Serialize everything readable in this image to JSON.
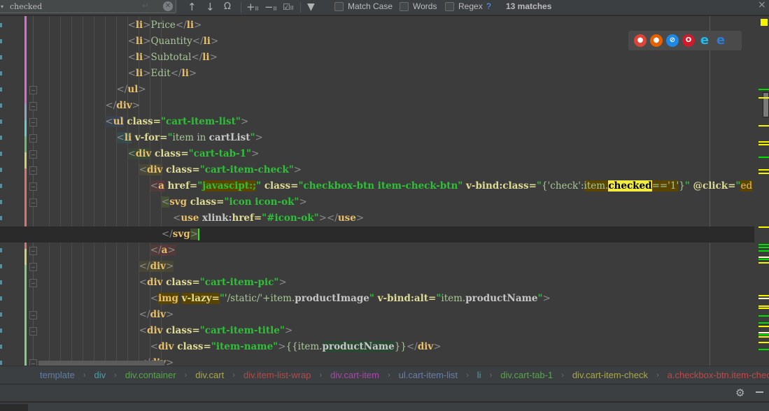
{
  "findbar": {
    "query": "checked",
    "match_case_label": "Match Case",
    "words_label": "Words",
    "regex_label": "Regex",
    "help_label": "?",
    "matches_text": "13 matches",
    "icons": [
      "history-dropdown-icon",
      "enter-icon",
      "clear-icon",
      "previous-occurrence-icon",
      "next-occurrence-icon",
      "select-all-occurrences-icon",
      "add-selection-icon",
      "remove-selection-icon",
      "select-all-icon",
      "filter-icon",
      "close-icon"
    ]
  },
  "editor": {
    "lines": [
      {
        "indent": 12,
        "parts": [
          [
            "br",
            "<"
          ],
          [
            "tagname",
            "li"
          ],
          [
            "br",
            ">"
          ],
          [
            "txt",
            "Price"
          ],
          [
            "br",
            "</"
          ],
          [
            "tagname",
            "li"
          ],
          [
            "br",
            ">"
          ]
        ]
      },
      {
        "indent": 12,
        "parts": [
          [
            "br",
            "<"
          ],
          [
            "tagname",
            "li"
          ],
          [
            "br",
            ">"
          ],
          [
            "txt",
            "Quantity"
          ],
          [
            "br",
            "</"
          ],
          [
            "tagname",
            "li"
          ],
          [
            "br",
            ">"
          ]
        ]
      },
      {
        "indent": 12,
        "parts": [
          [
            "br",
            "<"
          ],
          [
            "tagname",
            "li"
          ],
          [
            "br",
            ">"
          ],
          [
            "txt",
            "Subtotal"
          ],
          [
            "br",
            "</"
          ],
          [
            "tagname",
            "li"
          ],
          [
            "br",
            ">"
          ]
        ]
      },
      {
        "indent": 12,
        "parts": [
          [
            "br",
            "<"
          ],
          [
            "tagname",
            "li"
          ],
          [
            "br",
            ">"
          ],
          [
            "txt",
            "Edit"
          ],
          [
            "br",
            "</"
          ],
          [
            "tagname",
            "li"
          ],
          [
            "br",
            ">"
          ]
        ]
      },
      {
        "indent": 10,
        "parts": [
          [
            "br",
            "</"
          ],
          [
            "tagname",
            "ul"
          ],
          [
            "br",
            ">"
          ]
        ]
      },
      {
        "indent": 8,
        "parts": [
          [
            "br",
            "</"
          ],
          [
            "tagname",
            "div"
          ],
          [
            "br",
            ">"
          ]
        ]
      },
      {
        "indent": 8,
        "parts": [
          [
            "br hl-ul",
            "<"
          ],
          [
            "tagname hl-ul",
            "ul"
          ],
          [
            "attr",
            " class="
          ],
          [
            "str",
            "\"cart-item-list\""
          ],
          [
            "br",
            ">"
          ]
        ]
      },
      {
        "indent": 10,
        "parts": [
          [
            "br hl-li",
            "<"
          ],
          [
            "tagname hl-li",
            "li"
          ],
          [
            "attr",
            " v-for="
          ],
          [
            "str",
            "\""
          ],
          [
            "txt",
            "item in "
          ],
          [
            "jsb",
            "cartList"
          ],
          [
            "str",
            "\""
          ],
          [
            "br",
            ">"
          ]
        ]
      },
      {
        "indent": 12,
        "parts": [
          [
            "br hl-div1",
            "<"
          ],
          [
            "tagname hl-div1",
            "div"
          ],
          [
            "attr",
            " class="
          ],
          [
            "str",
            "\"cart-tab-1\""
          ],
          [
            "br",
            ">"
          ]
        ]
      },
      {
        "indent": 14,
        "parts": [
          [
            "br hl-div2",
            "<"
          ],
          [
            "tagname hl-div2",
            "div"
          ],
          [
            "attr",
            " class="
          ],
          [
            "str",
            "\"cart-item-check\""
          ],
          [
            "br",
            ">"
          ]
        ]
      },
      {
        "indent": 16,
        "parts": [
          [
            "br hl-a",
            "<"
          ],
          [
            "tagname hl-a",
            "a"
          ],
          [
            "attr",
            " href="
          ],
          [
            "str",
            "\""
          ],
          [
            "str hl-ref",
            "javascipt:;"
          ],
          [
            "str",
            "\""
          ],
          [
            "attr",
            " class="
          ],
          [
            "str",
            "\"checkbox-btn item-check-btn\""
          ],
          [
            "attr",
            " v-bind:class="
          ],
          [
            "str",
            "\""
          ],
          [
            "txt",
            "{'check':"
          ],
          [
            "txt hl-ref",
            "item."
          ],
          [
            "hl-search",
            "checked"
          ],
          [
            "txt hl-ref",
            "=='1'"
          ],
          [
            "txt",
            "}"
          ],
          [
            "str",
            "\""
          ],
          [
            "attr",
            " @click="
          ],
          [
            "str",
            "\""
          ],
          [
            "tag hl-ref",
            "ed"
          ]
        ]
      },
      {
        "indent": 18,
        "parts": [
          [
            "br hl-svg",
            "<"
          ],
          [
            "tagname",
            "svg"
          ],
          [
            "attr",
            " class="
          ],
          [
            "str",
            "\"icon icon-ok\""
          ],
          [
            "br",
            ">"
          ]
        ]
      },
      {
        "indent": 20,
        "parts": [
          [
            "br",
            "<"
          ],
          [
            "tagname",
            "use"
          ],
          [
            "jsb",
            " xlink:"
          ],
          [
            "attr",
            "href="
          ],
          [
            "str",
            "\"#icon-ok\""
          ],
          [
            "br",
            "></"
          ],
          [
            "tagname",
            "use"
          ],
          [
            "br",
            ">"
          ]
        ]
      },
      {
        "indent": 18,
        "parts": [
          [
            "br",
            "</"
          ],
          [
            "tagname",
            "svg"
          ],
          [
            "br hl-svg",
            ">"
          ]
        ],
        "current": true
      },
      {
        "indent": 16,
        "parts": [
          [
            "br hl-a",
            "</"
          ],
          [
            "tagname hl-a",
            "a"
          ],
          [
            "br hl-a",
            ">"
          ]
        ]
      },
      {
        "indent": 14,
        "parts": [
          [
            "br hl-div2",
            "</"
          ],
          [
            "tagname hl-div2",
            "div"
          ],
          [
            "br hl-div2",
            ">"
          ]
        ]
      },
      {
        "indent": 14,
        "parts": [
          [
            "br",
            "<"
          ],
          [
            "tagname",
            "div"
          ],
          [
            "attr",
            " class="
          ],
          [
            "str",
            "\"cart-item-pic\""
          ],
          [
            "br",
            ">"
          ]
        ]
      },
      {
        "indent": 16,
        "parts": [
          [
            "br",
            "<"
          ],
          [
            "tagname hl-ref",
            "img"
          ],
          [
            "jsb",
            " "
          ],
          [
            "attr hl-ref",
            "v-lazy="
          ],
          [
            "str",
            "\""
          ],
          [
            "txt",
            "'/static/'+item."
          ],
          [
            "jsb",
            "productImage"
          ],
          [
            "str",
            "\""
          ],
          [
            "attr",
            " v-bind:alt="
          ],
          [
            "str",
            "\""
          ],
          [
            "txt",
            "item."
          ],
          [
            "jsb",
            "productName"
          ],
          [
            "str",
            "\""
          ],
          [
            "br",
            ">"
          ]
        ]
      },
      {
        "indent": 14,
        "parts": [
          [
            "br",
            "</"
          ],
          [
            "tagname",
            "div"
          ],
          [
            "br",
            ">"
          ]
        ]
      },
      {
        "indent": 14,
        "parts": [
          [
            "br",
            "<"
          ],
          [
            "tagname",
            "div"
          ],
          [
            "attr",
            " class="
          ],
          [
            "str",
            "\"cart-item-title\""
          ],
          [
            "br",
            ">"
          ]
        ]
      },
      {
        "indent": 16,
        "parts": [
          [
            "br",
            "<"
          ],
          [
            "tagname",
            "div"
          ],
          [
            "attr",
            " class="
          ],
          [
            "str",
            "\"item-name\""
          ],
          [
            "br",
            ">"
          ],
          [
            "txt",
            "{{item."
          ],
          [
            "jsb hl-green",
            "productName"
          ],
          [
            "txt",
            "}}"
          ],
          [
            "br",
            "</"
          ],
          [
            "tagname",
            "div"
          ],
          [
            "br",
            ">"
          ]
        ]
      },
      {
        "indent": 14,
        "parts": [
          [
            "br",
            "</"
          ],
          [
            "tagname",
            "div"
          ],
          [
            "br",
            ">"
          ]
        ]
      }
    ],
    "browsers": [
      {
        "name": "chrome-icon",
        "glyph": "●",
        "color": "#db4437"
      },
      {
        "name": "firefox-icon",
        "glyph": "●",
        "color": "#e66000"
      },
      {
        "name": "safari-icon",
        "glyph": "⊘",
        "color": "#1e88e5"
      },
      {
        "name": "opera-icon",
        "glyph": "O",
        "color": "#cc1b2b"
      },
      {
        "name": "internet-explorer-icon",
        "glyph": "e",
        "color": "#1ebbee"
      },
      {
        "name": "edge-icon",
        "glyph": "e",
        "color": "#2b7cd3"
      }
    ]
  },
  "breadcrumbs": [
    {
      "label": "template",
      "color": "#5f7fa6"
    },
    {
      "label": "div",
      "color": "#4b9cab"
    },
    {
      "label": "div.container",
      "color": "#57a64a"
    },
    {
      "label": "div.cart",
      "color": "#a9a84b"
    },
    {
      "label": "div.item-list-wrap",
      "color": "#b14a4a"
    },
    {
      "label": "div.cart-item",
      "color": "#a44aa6"
    },
    {
      "label": "ul.cart-item-list",
      "color": "#6a7fa6"
    },
    {
      "label": "li",
      "color": "#4b9cab"
    },
    {
      "label": "div.cart-tab-1",
      "color": "#57a64a"
    },
    {
      "label": "div.cart-item-check",
      "color": "#a9a84b"
    },
    {
      "label": "a.checkbox-btn.item-check-btn",
      "color": "#c24848"
    }
  ],
  "colors": {
    "search_highlight": "#f2ec3f",
    "caret": "#36e02e",
    "error_stripe": "#f5f500"
  }
}
